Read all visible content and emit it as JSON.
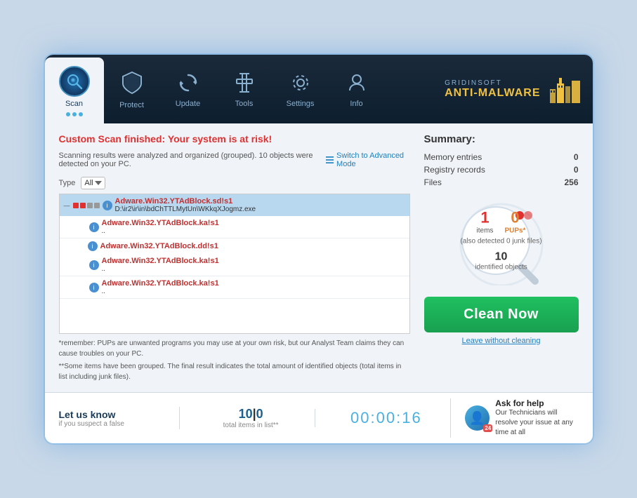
{
  "app": {
    "brand_name": "GRIDINSOFT",
    "product_name": "ANTI-MALWARE"
  },
  "nav": {
    "tabs": [
      {
        "id": "scan",
        "label": "Scan",
        "active": true,
        "icon": "👁"
      },
      {
        "id": "protect",
        "label": "Protect",
        "active": false,
        "icon": "🛡"
      },
      {
        "id": "update",
        "label": "Update",
        "active": false,
        "icon": "🔄"
      },
      {
        "id": "tools",
        "label": "Tools",
        "active": false,
        "icon": "🔧"
      },
      {
        "id": "settings",
        "label": "Settings",
        "active": false,
        "icon": "⚙"
      },
      {
        "id": "info",
        "label": "Info",
        "active": false,
        "icon": "👤"
      }
    ]
  },
  "scan": {
    "title_prefix": "Custom Scan finished: ",
    "title_risk": "Your system is at risk!",
    "subtitle": "Scanning results were analyzed and organized (grouped). 10 objects were detected on your PC.",
    "switch_mode": "Switch to Advanced Mode",
    "filter_label": "Type",
    "filter_value": "All",
    "results": [
      {
        "id": 1,
        "threat": "Adware.Win32.YTAdBlock.sd!s1",
        "path": "D:\\ir2\\ir\\in\\bdChTTLMytUn\\WKkqXJogmz.exe",
        "selected": true,
        "is_parent": true
      },
      {
        "id": 2,
        "threat": "Adware.Win32.YTAdBlock.ka!s1",
        "path": "..",
        "selected": false,
        "is_parent": false
      },
      {
        "id": 3,
        "threat": "Adware.Win32.YTAdBlock.dd!s1",
        "path": "",
        "selected": false,
        "is_parent": false
      },
      {
        "id": 4,
        "threat": "Adware.Win32.YTAdBlock.ka!s1",
        "path": "..",
        "selected": false,
        "is_parent": false
      },
      {
        "id": 5,
        "threat": "Adware.Win32.YTAdBlock.ka!s1",
        "path": "..",
        "selected": false,
        "is_parent": false
      }
    ],
    "note1": "*remember: PUPs are unwanted programs you may use at your own risk, but our Analyst Team claims they can cause troubles on your PC.",
    "note2": "**Some items have been grouped. The final result indicates the total amount of identified objects (total items in list including junk files)."
  },
  "summary": {
    "title": "Summary:",
    "memory_label": "Memory entries",
    "memory_value": "0",
    "registry_label": "Registry records",
    "registry_value": "0",
    "files_label": "Files",
    "files_value": "256",
    "items_count": "1",
    "pups_count": "0",
    "items_label": "items",
    "pups_label": "PUPs*",
    "detected_junk": "(also detected 0 junk files)",
    "identified_count": "10",
    "identified_label": "identified objects"
  },
  "actions": {
    "clean_now": "Clean Now",
    "leave_without": "Leave without cleaning"
  },
  "bottom": {
    "let_us_know": "Let us know",
    "let_us_sub": "if you suspect a false",
    "items_count": "10",
    "items_zero": "0",
    "items_label": "total items in list**",
    "timer": "00:00:16",
    "help_title": "Ask for help",
    "help_text": "Our Technicians will resolve your issue at any time at all"
  }
}
